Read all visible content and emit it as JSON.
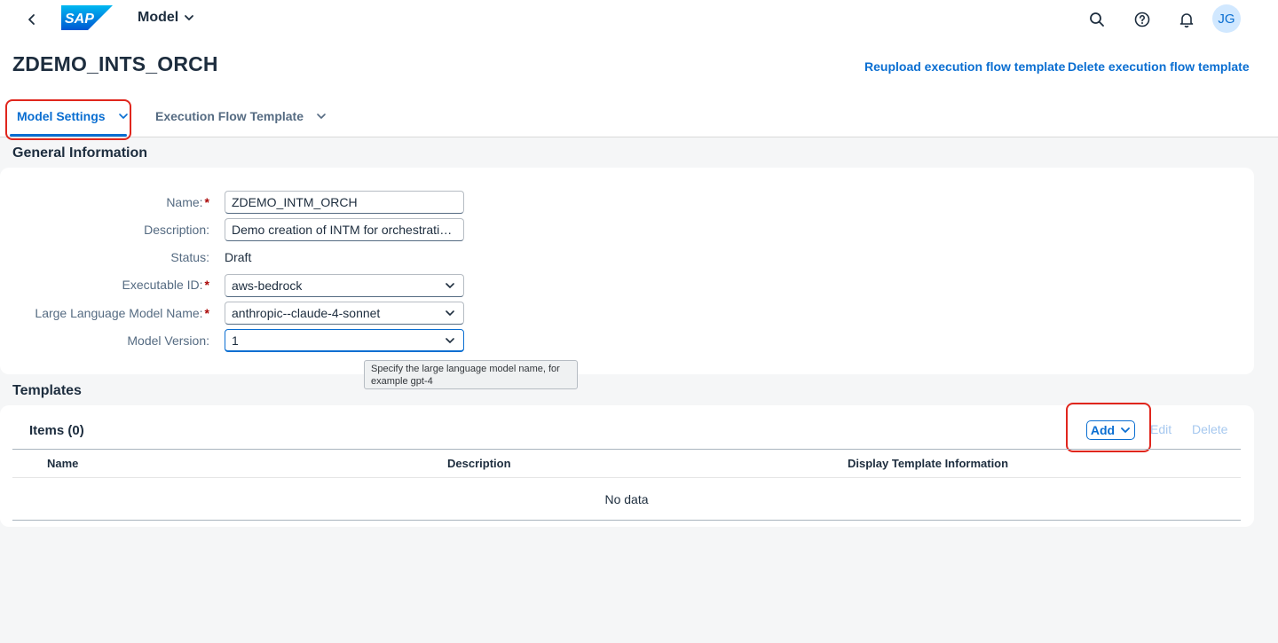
{
  "shellbar": {
    "logo_text": "SAP",
    "title": "Model",
    "icons": [
      "back-icon",
      "search-icon",
      "help-icon",
      "bell-icon"
    ],
    "avatar_initials": "JG"
  },
  "header": {
    "title": "ZDEMO_INTS_ORCH",
    "actions": {
      "reupload": "Reupload execution flow template",
      "delete": "Delete execution flow template"
    },
    "tabs": [
      {
        "label": "Model Settings",
        "active": true
      },
      {
        "label": "Execution Flow Template",
        "active": false
      }
    ]
  },
  "general": {
    "title": "General Information",
    "fields": {
      "name": {
        "label": "Name:",
        "required": "*",
        "value": "ZDEMO_INTM_ORCH"
      },
      "description": {
        "label": "Description:",
        "value": "Demo creation of INTM for orchestration..."
      },
      "status": {
        "label": "Status:",
        "value": "Draft"
      },
      "executable_id": {
        "label": "Executable ID:",
        "required": "*",
        "value": "aws-bedrock"
      },
      "llm_name": {
        "label": "Large Language Model Name:",
        "required": "*",
        "value": "anthropic--claude-4-sonnet"
      },
      "model_version": {
        "label": "Model Version:",
        "value": "1"
      }
    },
    "tooltip": "Specify the large language model name, for example gpt-4"
  },
  "templates": {
    "title": "Templates",
    "items_title": "Items (0)",
    "toolbar": {
      "add": "Add",
      "edit": "Edit",
      "delete": "Delete"
    },
    "columns": [
      "Name",
      "Description",
      "Display Template Information"
    ],
    "empty_text": "No data"
  },
  "colors": {
    "brand": "#0a6ed1",
    "highlight": "#e0261d",
    "required": "#aa0808"
  }
}
